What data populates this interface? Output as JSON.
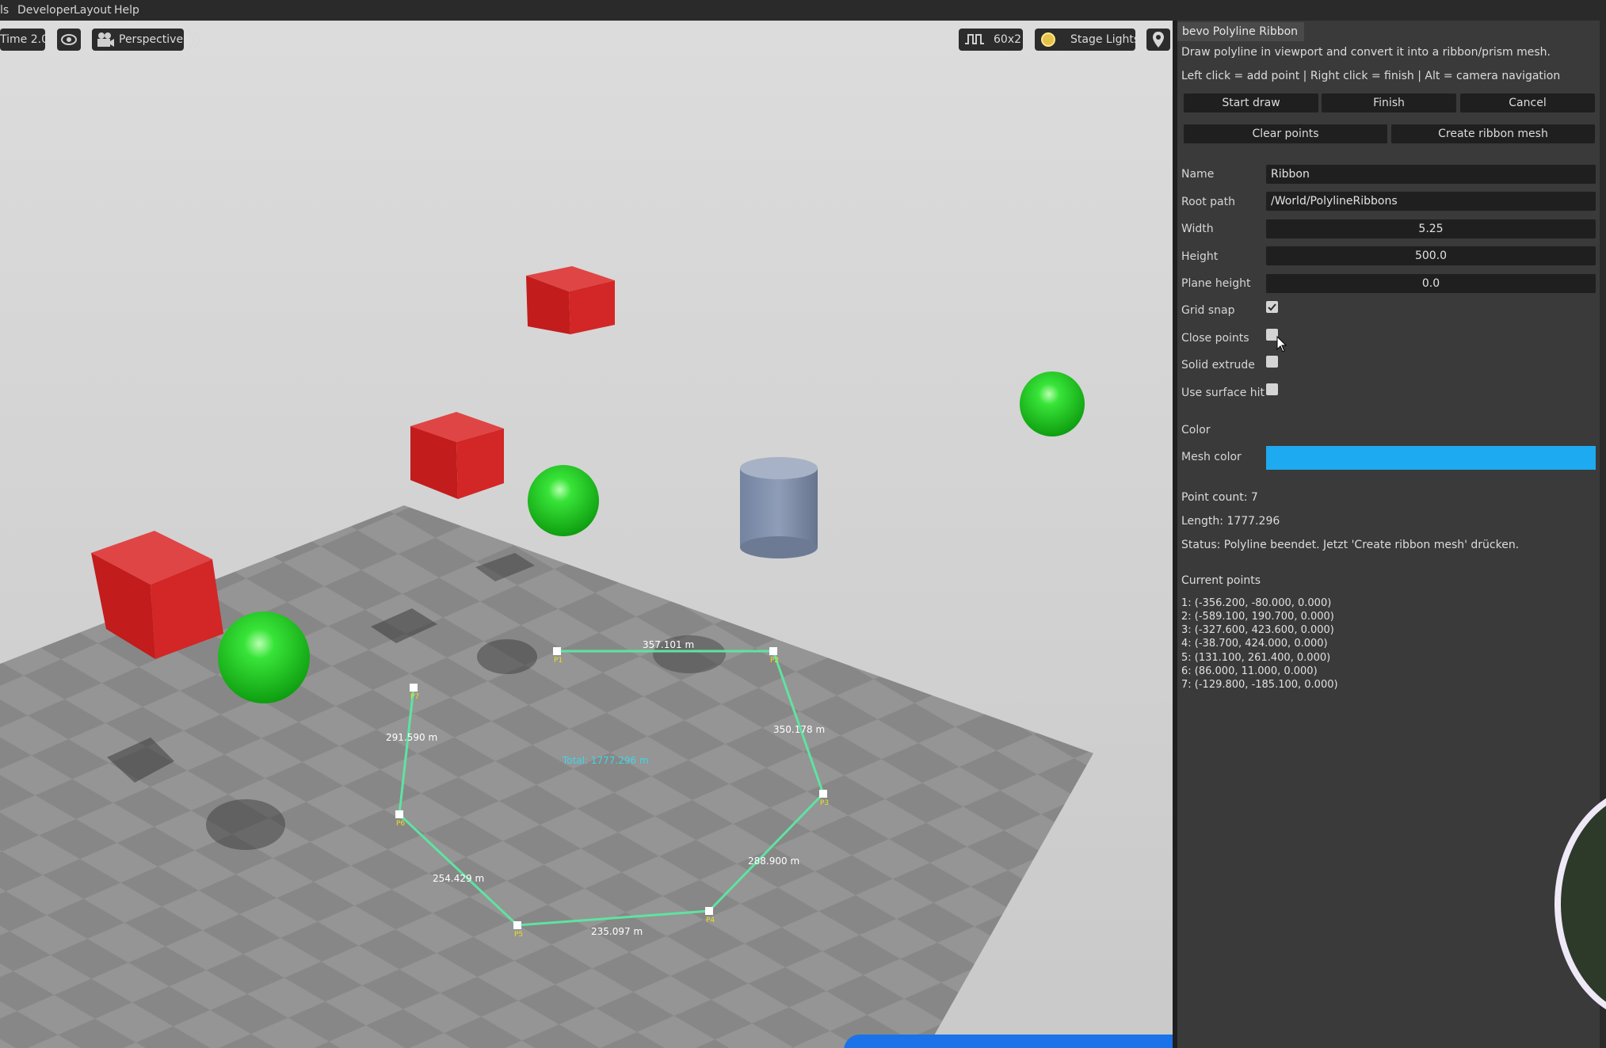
{
  "menubar": {
    "items": [
      "ls",
      "Developer",
      "Layout",
      "Help"
    ]
  },
  "viewport_toolbar": {
    "time_label": "Time 2.0",
    "camera_label": "Perspective",
    "resolution_label": "60x2",
    "lighting_label": "Stage Lights"
  },
  "overlay": {
    "segments": [
      "357.101 m",
      "350.178 m",
      "288.900 m",
      "235.097 m",
      "254.429 m",
      "291.590 m"
    ],
    "vertices": [
      "P1",
      "P2",
      "P3",
      "P4",
      "P5",
      "P6",
      "P7"
    ],
    "total": "Total: 1777.296 m",
    "line_color": "#5ee3a1",
    "total_color": "#3fd7e6"
  },
  "panel": {
    "title": "bevo Polyline Ribbon",
    "description": "Draw polyline in viewport and convert it into a ribbon/prism mesh.",
    "hint": "Left click = add point | Right click = finish | Alt = camera navigation",
    "buttons": {
      "start_draw": "Start draw",
      "finish": "Finish",
      "cancel": "Cancel",
      "clear_points": "Clear points",
      "create_ribbon_mesh": "Create ribbon mesh"
    },
    "fields": {
      "name": {
        "label": "Name",
        "value": "Ribbon"
      },
      "root_path": {
        "label": "Root path",
        "value": "/World/PolylineRibbons"
      },
      "width": {
        "label": "Width",
        "value": "5.25"
      },
      "height": {
        "label": "Height",
        "value": "500.0"
      },
      "plane_height": {
        "label": "Plane height",
        "value": "0.0"
      }
    },
    "toggles": {
      "grid_snap": {
        "label": "Grid snap",
        "checked": true
      },
      "close_points": {
        "label": "Close points",
        "checked": false
      },
      "solid_extrude": {
        "label": "Solid extrude",
        "checked": false
      },
      "use_surface_hit": {
        "label": "Use surface hit",
        "checked": false
      }
    },
    "color_section": "Color",
    "mesh_color": {
      "label": "Mesh color",
      "value": "#1eaaf0"
    },
    "point_count": "Point count: 7",
    "length": "Length: 1777.296",
    "status": "Status: Polyline beendet. Jetzt 'Create ribbon mesh' drücken.",
    "current_points_header": "Current points",
    "current_points": [
      "1: (-356.200, -80.000, 0.000)",
      "2: (-589.100, 190.700, 0.000)",
      "3: (-327.600, 423.600, 0.000)",
      "4: (-38.700, 424.000, 0.000)",
      "5: (131.100, 261.400, 0.000)",
      "6: (86.000, 11.000, 0.000)",
      "7: (-129.800, -185.100, 0.000)"
    ]
  }
}
